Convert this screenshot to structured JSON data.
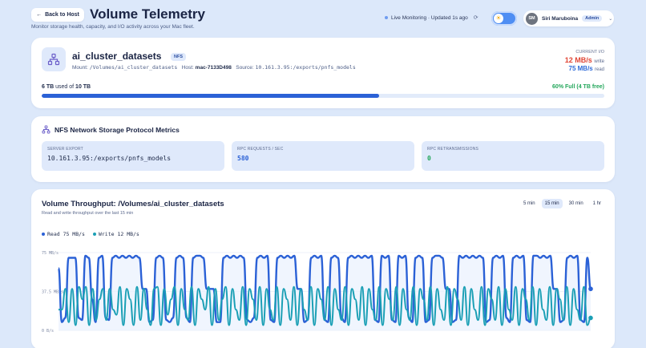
{
  "header": {
    "back_label": "Back to Host",
    "title": "Volume Telemetry",
    "subtitle": "Monitor storage health, capacity, and I/O activity across your Mac fleet.",
    "live_status": "Live Monitoring · Updated 1s ago",
    "user": {
      "initials": "SM",
      "name": "Siri Maruboina",
      "role": "Admin"
    }
  },
  "volume": {
    "name": "ai_cluster_datasets",
    "badge": "NFS",
    "mount_label": "Mount:",
    "mount": "/Volumes/ai_cluster_datasets",
    "host_label": "Host:",
    "host": "mac-7133D498",
    "source_label": "Source:",
    "source": "10.161.3.95:/exports/pnfs_models",
    "io": {
      "label": "CURRENT I/O",
      "write_value": "12 MB/s",
      "write_unit": "write",
      "read_value": "75 MB/s",
      "read_unit": "read"
    },
    "used_amount": "6 TB",
    "used_of": "used of",
    "total": "10 TB",
    "full_text": "60% Full (4 TB free)",
    "usage_fraction": 0.6
  },
  "nfs": {
    "title": "NFS Network Storage Protocol Metrics",
    "tiles": [
      {
        "label": "SERVER EXPORT",
        "value": "10.161.3.95:/exports/pnfs_models"
      },
      {
        "label": "RPC REQUESTS / SEC",
        "value": "580"
      },
      {
        "label": "RPC RETRANSMISSIONS",
        "value": "0"
      }
    ]
  },
  "throughput": {
    "title": "Volume Throughput: /Volumes/ai_cluster_datasets",
    "subtitle": "Read and write throughput over the last 15 min",
    "ranges": [
      "5 min",
      "15 min",
      "30 min",
      "1 hr"
    ],
    "active_range": "15 min"
  },
  "colors": {
    "accent": "#2b61d6",
    "write": "#e04434",
    "success": "#22a65a",
    "read_series": "#2b61d6",
    "write_series": "#1a9fb5"
  },
  "chart_data": {
    "type": "line",
    "series": [
      {
        "name": "Read 75 MB/s",
        "values": [
          60,
          8,
          12,
          70,
          70,
          70,
          12,
          10,
          72,
          70,
          30,
          8,
          70,
          72,
          12,
          10,
          70,
          72,
          70,
          72,
          70,
          72,
          70,
          72,
          70,
          40,
          40,
          8,
          10,
          70,
          72,
          70,
          10,
          8,
          12,
          70,
          72,
          70,
          12,
          8,
          70,
          72,
          72,
          70,
          40,
          40,
          40,
          8,
          8,
          70,
          72,
          70,
          72,
          70,
          72,
          70,
          10,
          8,
          12,
          70,
          72,
          70,
          72,
          10,
          8,
          70,
          72,
          70,
          72,
          70,
          72,
          40,
          40,
          8,
          10,
          70,
          72,
          70,
          72,
          10,
          8,
          70,
          72,
          70,
          12,
          8,
          70,
          72,
          70,
          72,
          70,
          72,
          70,
          72,
          10,
          8,
          72,
          70,
          72,
          10,
          8,
          72,
          70,
          72,
          12,
          8,
          70,
          72,
          70,
          8,
          10,
          70,
          72,
          72,
          70,
          40,
          40,
          8,
          10,
          72,
          70,
          72,
          70,
          72,
          70,
          72,
          70,
          8,
          10,
          70,
          72,
          70,
          72,
          12,
          8,
          70,
          72,
          70,
          72,
          10,
          8,
          72,
          72,
          70,
          72,
          70,
          72,
          40,
          40,
          8,
          10,
          70,
          72,
          70,
          72,
          10,
          8,
          70,
          40
        ]
      },
      {
        "name": "Write 12 MB/s",
        "values": [
          20,
          20,
          40,
          8,
          40,
          5,
          42,
          30,
          42,
          5,
          40,
          10,
          30,
          40,
          10,
          40,
          20,
          15,
          42,
          5,
          40,
          30,
          5,
          42,
          10,
          40,
          20,
          5,
          40,
          42,
          5,
          40,
          15,
          30,
          42,
          5,
          40,
          20,
          10,
          42,
          5,
          40,
          30,
          20,
          42,
          5,
          40,
          10,
          30,
          42,
          5,
          40,
          20,
          10,
          42,
          5,
          40,
          30,
          10,
          42,
          5,
          40,
          20,
          10,
          42,
          5,
          40,
          30,
          10,
          42,
          5,
          40,
          20,
          10,
          42,
          5,
          40,
          30,
          10,
          42,
          5,
          40,
          20,
          10,
          42,
          5,
          40,
          30,
          10,
          42,
          5,
          40,
          20,
          10,
          42,
          5,
          40,
          30,
          10,
          42,
          5,
          40,
          20,
          10,
          42,
          5,
          40,
          30,
          10,
          42,
          5,
          40,
          20,
          10,
          42,
          5,
          40,
          30,
          10,
          42,
          5,
          40,
          20,
          10,
          42,
          5,
          40,
          30,
          10,
          42,
          5,
          40,
          20,
          10,
          42,
          5,
          40,
          30,
          10,
          42,
          5,
          40,
          20,
          10,
          42,
          5,
          40,
          30,
          10,
          42,
          5,
          40,
          20,
          10,
          42,
          5,
          12
        ]
      }
    ],
    "ylim": [
      0,
      75
    ],
    "y_ticks": [
      "75 MB/s",
      "37.5 MB/s",
      "0 B/s"
    ],
    "legend": "top-left",
    "grid": true
  }
}
